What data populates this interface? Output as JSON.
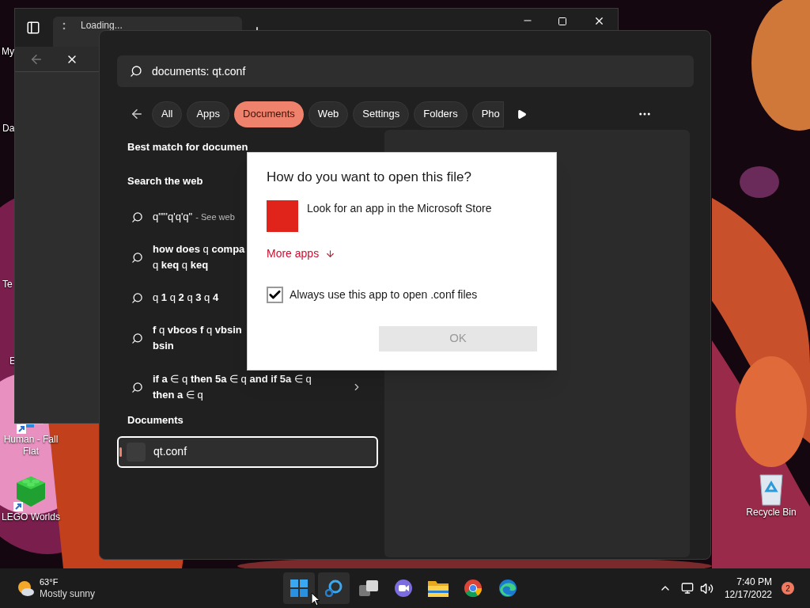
{
  "desktop": {
    "icons": [
      {
        "label": "My",
        "kind": "hidden"
      },
      {
        "label": "Da",
        "kind": "hidden"
      },
      {
        "label": "Te",
        "kind": "hidden"
      },
      {
        "label": "E",
        "kind": "hidden"
      },
      {
        "label": "Human - Fall Flat",
        "kind": "game"
      },
      {
        "label": "LEGO Worlds",
        "kind": "brick"
      },
      {
        "label": "Recycle Bin",
        "kind": "bin"
      }
    ]
  },
  "browser": {
    "tabs": [
      {
        "label": "Loading...",
        "selected": true
      }
    ]
  },
  "search": {
    "query": "documents: qt.conf",
    "filters": [
      {
        "label": "All",
        "selected": false
      },
      {
        "label": "Apps",
        "selected": false
      },
      {
        "label": "Documents",
        "selected": true
      },
      {
        "label": "Web",
        "selected": false
      },
      {
        "label": "Settings",
        "selected": false
      },
      {
        "label": "Folders",
        "selected": false
      },
      {
        "label": "Pho",
        "selected": false
      }
    ],
    "best_match_heading": "Best match for documen",
    "web_heading": "Search the web",
    "web_results": [
      {
        "lines": [
          "q\"\"'q'q'q\""
        ],
        "suffix": "- See web"
      },
      {
        "lines": [
          "**how does** q **compa**",
          "q **keq** q **keq**"
        ]
      },
      {
        "lines": [
          "q **1** q **2** q **3** q **4**"
        ]
      },
      {
        "lines": [
          "**f** q **vbcos f** q **vbsin**",
          "**bsin**"
        ]
      },
      {
        "lines": [
          "**if a** ∈ q **then 5a** ∈ q **and if 5a** ∈ q",
          "**then a** ∈ q"
        ],
        "expandable": true
      }
    ],
    "documents_heading": "Documents",
    "documents": [
      {
        "name": "qt.conf",
        "selected": true
      }
    ]
  },
  "dialog": {
    "title": "How do you want to open this file?",
    "option": "Look for an app in the Microsoft Store",
    "more_apps": "More apps",
    "always_use": {
      "label": "Always use this app to open .conf files",
      "checked": true
    },
    "ok": {
      "label": "OK",
      "disabled": true
    }
  },
  "taskbar": {
    "weather": {
      "temperature": "63°F",
      "condition": "Mostly sunny"
    },
    "apps": [
      {
        "kind": "start",
        "selected": true
      },
      {
        "kind": "search",
        "selected": true
      },
      {
        "kind": "taskview",
        "selected": false
      },
      {
        "kind": "chat",
        "selected": false
      },
      {
        "kind": "explorer",
        "selected": false
      },
      {
        "kind": "chrome",
        "selected": false
      },
      {
        "kind": "edge",
        "selected": false
      }
    ],
    "clock": {
      "time": "7:40 PM",
      "date": "12/17/2022"
    },
    "notifications": "2"
  }
}
